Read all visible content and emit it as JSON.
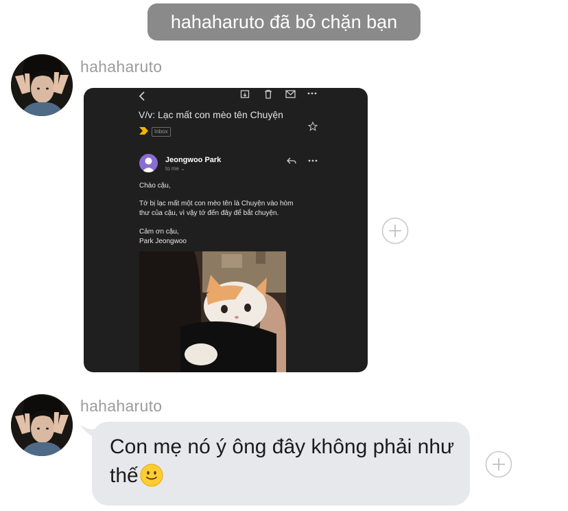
{
  "system_notice": "hahaharuto đã bỏ chặn bạn",
  "messages": [
    {
      "sender": "hahaharuto",
      "type": "image",
      "email": {
        "subject": "V/v: Lạc mất con mèo tên Chuyện",
        "label": "Inbox",
        "from": "Jeongwoo Park",
        "to": "to me",
        "body": [
          "Chào cậu,",
          "Tớ bị lạc mất một con mèo tên là Chuyện vào hòm",
          "thư của cậu, vì vậy tớ đến đây để bắt chuyện.",
          "Cảm ơn cậu,",
          "Park Jeongwoo"
        ]
      }
    },
    {
      "sender": "hahaharuto",
      "type": "text",
      "text": "Con mẹ nó ý ông đây không phải như thế",
      "emoji": "slightly-smiling-face"
    }
  ],
  "colors": {
    "system_pill": "#8a8a8a",
    "bubble": "#e7e8eb",
    "sender_name": "#9b9b9b",
    "email_bg": "#1f1f1f",
    "email_avatar": "#8b6dd1"
  }
}
